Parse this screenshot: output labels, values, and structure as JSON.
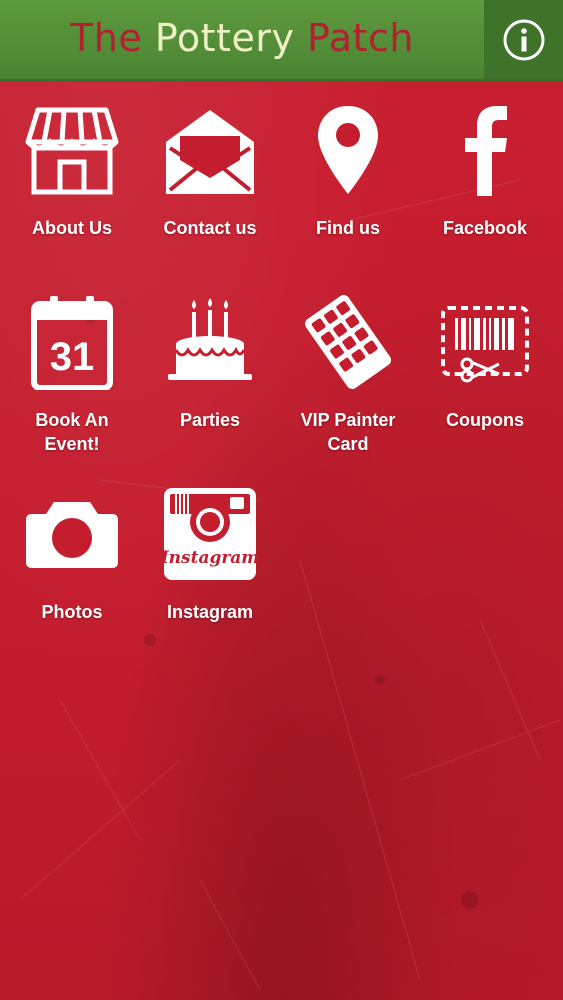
{
  "header": {
    "title_words": [
      "The",
      "Pottery",
      "Patch"
    ],
    "info_icon": "info-circle-icon"
  },
  "colors": {
    "background": "#c41d2e",
    "header": "#5e9a3f",
    "info_button": "#3f7329",
    "title_red": "#b3202f",
    "title_cream": "#eef0c6"
  },
  "menu": {
    "items": [
      {
        "label": "About Us",
        "icon": "storefront-icon"
      },
      {
        "label": "Contact us",
        "icon": "envelope-icon"
      },
      {
        "label": "Find us",
        "icon": "map-pin-icon"
      },
      {
        "label": "Facebook",
        "icon": "facebook-icon"
      },
      {
        "label_lines": [
          "Book An",
          "Event!"
        ],
        "icon": "calendar-icon",
        "calendar_day": "31"
      },
      {
        "label": "Parties",
        "icon": "birthday-cake-icon"
      },
      {
        "label_lines": [
          "VIP Painter",
          "Card"
        ],
        "icon": "punch-card-icon"
      },
      {
        "label": "Coupons",
        "icon": "coupon-scissors-icon"
      },
      {
        "label": "Photos",
        "icon": "camera-icon"
      },
      {
        "label": "Instagram",
        "icon": "instagram-icon",
        "logo_text": "Instagram"
      }
    ]
  }
}
